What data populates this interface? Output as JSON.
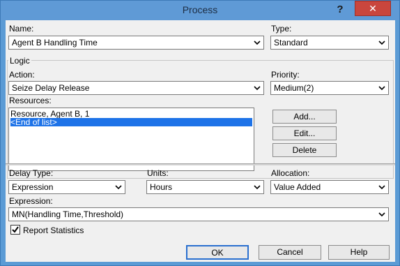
{
  "window": {
    "title": "Process",
    "help_glyph": "?",
    "close_glyph": "✕"
  },
  "name_field": {
    "label": "Name:",
    "value": "Agent B Handling Time"
  },
  "type_field": {
    "label": "Type:",
    "value": "Standard"
  },
  "logic": {
    "group_title": "Logic",
    "action": {
      "label": "Action:",
      "value": "Seize Delay Release"
    },
    "priority": {
      "label": "Priority:",
      "value": "Medium(2)"
    },
    "resources": {
      "label": "Resources:",
      "items": [
        "Resource, Agent B, 1",
        "<End of list>"
      ],
      "selected_index": 1
    },
    "buttons": {
      "add": "Add...",
      "edit": "Edit...",
      "delete": "Delete"
    }
  },
  "delay": {
    "delay_type": {
      "label": "Delay Type:",
      "value": "Expression"
    },
    "units": {
      "label": "Units:",
      "value": "Hours"
    },
    "allocation": {
      "label": "Allocation:",
      "value": "Value Added"
    },
    "expression": {
      "label": "Expression:",
      "value": "MN(Handling Time,Threshold)"
    }
  },
  "report_statistics": {
    "label": "Report Statistics",
    "checked": true
  },
  "footer": {
    "ok": "OK",
    "cancel": "Cancel",
    "help": "Help"
  },
  "colors": {
    "titlebar": "#5f9ad6",
    "close_button": "#c9463d",
    "selection": "#1e73e8",
    "client_bg": "#f0f0f0"
  }
}
